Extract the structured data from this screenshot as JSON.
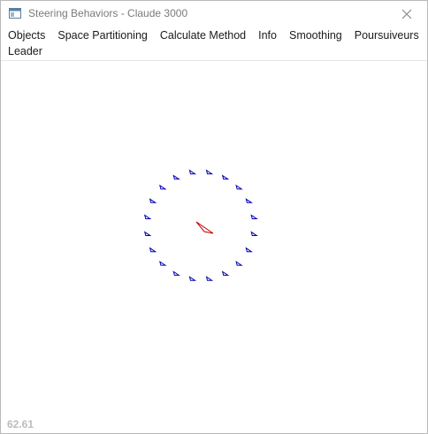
{
  "window": {
    "title": "Steering Behaviors - Claude 3000",
    "icon": "app-window-icon",
    "close_icon": "close-icon"
  },
  "menu": {
    "items": [
      {
        "label": "Objects"
      },
      {
        "label": "Space Partitioning"
      },
      {
        "label": "Calculate Method"
      },
      {
        "label": "Info"
      },
      {
        "label": "Smoothing"
      },
      {
        "label": "Poursuiveurs"
      },
      {
        "label": "Leader"
      }
    ]
  },
  "scene": {
    "leader_color": "#c00000",
    "pursuer_color": "#0000b0",
    "pursuer_count": 20
  },
  "status": {
    "fps": "62.61"
  }
}
